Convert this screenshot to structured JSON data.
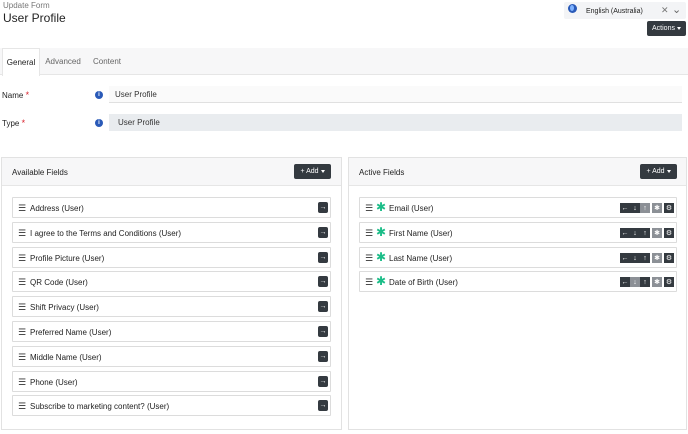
{
  "header": {
    "subtitle": "Update Form",
    "title": "User Profile"
  },
  "language": {
    "value": "English (Australia)",
    "clear_symbol": "✕",
    "chevron_symbol": "⌄"
  },
  "actions": {
    "label": "Actions"
  },
  "tabs": [
    {
      "label": "General",
      "active": true
    },
    {
      "label": "Advanced",
      "active": false
    },
    {
      "label": "Content",
      "active": false
    }
  ],
  "fields": {
    "name": {
      "label": "Name",
      "required_mark": "*",
      "value": "User Profile",
      "info": "i"
    },
    "type": {
      "label": "Type",
      "required_mark": "*",
      "value": "User Profile",
      "info": "i"
    }
  },
  "available": {
    "title": "Available Fields",
    "add_label": "+ Add",
    "items": [
      "Address (User)",
      "I agree to the Terms and Conditions (User)",
      "Profile Picture (User)",
      "QR Code (User)",
      "Shift Privacy (User)",
      "Preferred Name (User)",
      "Middle Name (User)",
      "Phone (User)",
      "Subscribe to marketing content? (User)"
    ]
  },
  "active": {
    "title": "Active Fields",
    "add_label": "+ Add",
    "items": [
      "Email (User)",
      "First Name (User)",
      "Last Name (User)",
      "Date of Birth (User)"
    ]
  },
  "glyphs": {
    "drag": "☰",
    "arrow_right": "→",
    "arrow_left": "←",
    "arrow_down": "↓",
    "arrow_up": "↑",
    "required_star": "✱",
    "asterisk": "✱",
    "gear": "⚙"
  },
  "colors": {
    "dark_button": "#343a40",
    "muted_button": "#8c9096",
    "required_green": "#1bbd88",
    "required_red": "#d9232e",
    "info_blue": "#2a5ab8"
  },
  "icons": [
    "globe-icon",
    "close-icon",
    "chevron-down-icon",
    "caret-down-icon",
    "info-icon",
    "drag-handle-icon",
    "arrow-right-icon",
    "arrow-left-icon",
    "arrow-down-icon",
    "arrow-up-icon",
    "asterisk-icon",
    "gear-icon"
  ]
}
